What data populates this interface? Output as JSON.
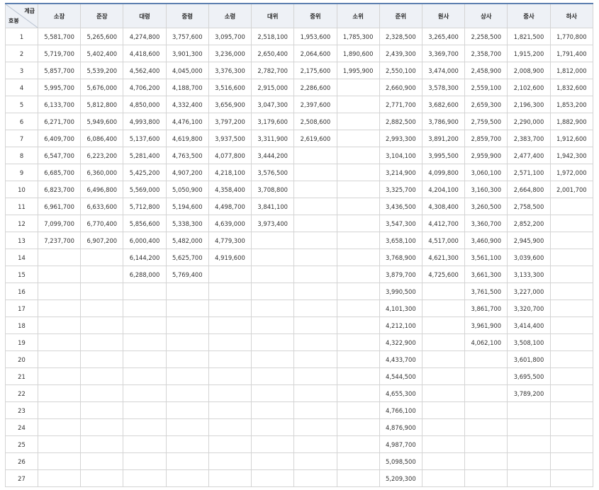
{
  "corner": {
    "top_right": "계급",
    "bottom_left": "호봉"
  },
  "columns": [
    "소장",
    "준장",
    "대령",
    "중령",
    "소령",
    "대위",
    "중위",
    "소위",
    "준위",
    "원사",
    "상사",
    "중사",
    "하사"
  ],
  "rows": [
    [
      "1",
      "5,581,700",
      "5,265,600",
      "4,274,800",
      "3,757,600",
      "3,095,700",
      "2,518,100",
      "1,953,600",
      "1,785,300",
      "2,328,500",
      "3,265,400",
      "2,258,500",
      "1,821,500",
      "1,770,800"
    ],
    [
      "2",
      "5,719,700",
      "5,402,400",
      "4,418,600",
      "3,901,300",
      "3,236,000",
      "2,650,400",
      "2,064,600",
      "1,890,600",
      "2,439,300",
      "3,369,700",
      "2,358,700",
      "1,915,200",
      "1,791,400"
    ],
    [
      "3",
      "5,857,700",
      "5,539,200",
      "4,562,400",
      "4,045,000",
      "3,376,300",
      "2,782,700",
      "2,175,600",
      "1,995,900",
      "2,550,100",
      "3,474,000",
      "2,458,900",
      "2,008,900",
      "1,812,000"
    ],
    [
      "4",
      "5,995,700",
      "5,676,000",
      "4,706,200",
      "4,188,700",
      "3,516,600",
      "2,915,000",
      "2,286,600",
      "",
      "2,660,900",
      "3,578,300",
      "2,559,100",
      "2,102,600",
      "1,832,600"
    ],
    [
      "5",
      "6,133,700",
      "5,812,800",
      "4,850,000",
      "4,332,400",
      "3,656,900",
      "3,047,300",
      "2,397,600",
      "",
      "2,771,700",
      "3,682,600",
      "2,659,300",
      "2,196,300",
      "1,853,200"
    ],
    [
      "6",
      "6,271,700",
      "5,949,600",
      "4,993,800",
      "4,476,100",
      "3,797,200",
      "3,179,600",
      "2,508,600",
      "",
      "2,882,500",
      "3,786,900",
      "2,759,500",
      "2,290,000",
      "1,882,900"
    ],
    [
      "7",
      "6,409,700",
      "6,086,400",
      "5,137,600",
      "4,619,800",
      "3,937,500",
      "3,311,900",
      "2,619,600",
      "",
      "2,993,300",
      "3,891,200",
      "2,859,700",
      "2,383,700",
      "1,912,600"
    ],
    [
      "8",
      "6,547,700",
      "6,223,200",
      "5,281,400",
      "4,763,500",
      "4,077,800",
      "3,444,200",
      "",
      "",
      "3,104,100",
      "3,995,500",
      "2,959,900",
      "2,477,400",
      "1,942,300"
    ],
    [
      "9",
      "6,685,700",
      "6,360,000",
      "5,425,200",
      "4,907,200",
      "4,218,100",
      "3,576,500",
      "",
      "",
      "3,214,900",
      "4,099,800",
      "3,060,100",
      "2,571,100",
      "1,972,000"
    ],
    [
      "10",
      "6,823,700",
      "6,496,800",
      "5,569,000",
      "5,050,900",
      "4,358,400",
      "3,708,800",
      "",
      "",
      "3,325,700",
      "4,204,100",
      "3,160,300",
      "2,664,800",
      "2,001,700"
    ],
    [
      "11",
      "6,961,700",
      "6,633,600",
      "5,712,800",
      "5,194,600",
      "4,498,700",
      "3,841,100",
      "",
      "",
      "3,436,500",
      "4,308,400",
      "3,260,500",
      "2,758,500",
      ""
    ],
    [
      "12",
      "7,099,700",
      "6,770,400",
      "5,856,600",
      "5,338,300",
      "4,639,000",
      "3,973,400",
      "",
      "",
      "3,547,300",
      "4,412,700",
      "3,360,700",
      "2,852,200",
      ""
    ],
    [
      "13",
      "7,237,700",
      "6,907,200",
      "6,000,400",
      "5,482,000",
      "4,779,300",
      "",
      "",
      "",
      "3,658,100",
      "4,517,000",
      "3,460,900",
      "2,945,900",
      ""
    ],
    [
      "14",
      "",
      "",
      "6,144,200",
      "5,625,700",
      "4,919,600",
      "",
      "",
      "",
      "3,768,900",
      "4,621,300",
      "3,561,100",
      "3,039,600",
      ""
    ],
    [
      "15",
      "",
      "",
      "6,288,000",
      "5,769,400",
      "",
      "",
      "",
      "",
      "3,879,700",
      "4,725,600",
      "3,661,300",
      "3,133,300",
      ""
    ],
    [
      "16",
      "",
      "",
      "",
      "",
      "",
      "",
      "",
      "",
      "3,990,500",
      "",
      "3,761,500",
      "3,227,000",
      ""
    ],
    [
      "17",
      "",
      "",
      "",
      "",
      "",
      "",
      "",
      "",
      "4,101,300",
      "",
      "3,861,700",
      "3,320,700",
      ""
    ],
    [
      "18",
      "",
      "",
      "",
      "",
      "",
      "",
      "",
      "",
      "4,212,100",
      "",
      "3,961,900",
      "3,414,400",
      ""
    ],
    [
      "19",
      "",
      "",
      "",
      "",
      "",
      "",
      "",
      "",
      "4,322,900",
      "",
      "4,062,100",
      "3,508,100",
      ""
    ],
    [
      "20",
      "",
      "",
      "",
      "",
      "",
      "",
      "",
      "",
      "4,433,700",
      "",
      "",
      "3,601,800",
      ""
    ],
    [
      "21",
      "",
      "",
      "",
      "",
      "",
      "",
      "",
      "",
      "4,544,500",
      "",
      "",
      "3,695,500",
      ""
    ],
    [
      "22",
      "",
      "",
      "",
      "",
      "",
      "",
      "",
      "",
      "4,655,300",
      "",
      "",
      "3,789,200",
      ""
    ],
    [
      "23",
      "",
      "",
      "",
      "",
      "",
      "",
      "",
      "",
      "4,766,100",
      "",
      "",
      "",
      ""
    ],
    [
      "24",
      "",
      "",
      "",
      "",
      "",
      "",
      "",
      "",
      "4,876,900",
      "",
      "",
      "",
      ""
    ],
    [
      "25",
      "",
      "",
      "",
      "",
      "",
      "",
      "",
      "",
      "4,987,700",
      "",
      "",
      "",
      ""
    ],
    [
      "26",
      "",
      "",
      "",
      "",
      "",
      "",
      "",
      "",
      "5,098,500",
      "",
      "",
      "",
      ""
    ],
    [
      "27",
      "",
      "",
      "",
      "",
      "",
      "",
      "",
      "",
      "5,209,300",
      "",
      "",
      "",
      ""
    ]
  ]
}
